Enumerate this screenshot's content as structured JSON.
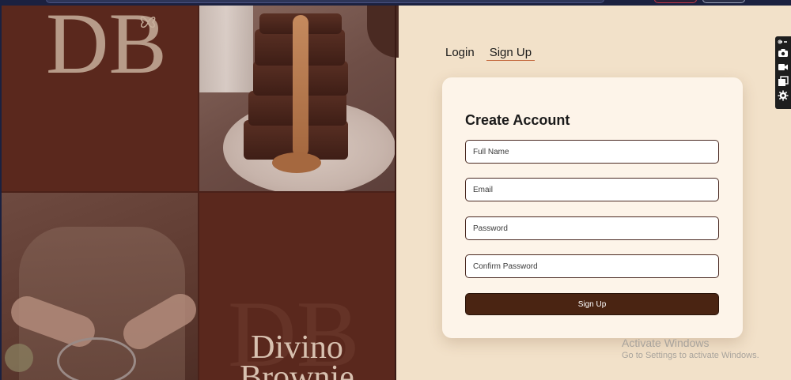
{
  "auth": {
    "tabs": [
      {
        "label": "Login",
        "active": false
      },
      {
        "label": "Sign Up",
        "active": true
      }
    ],
    "form": {
      "title": "Create Account",
      "full_name_placeholder": "Full Name",
      "email_placeholder": "Email",
      "password_placeholder": "Password",
      "confirm_password_placeholder": "Confirm Password",
      "submit_label": "Sign Up"
    }
  },
  "brand": {
    "name_line1": "Divino",
    "name_line2": "Brownie",
    "monogram": "DB"
  },
  "os_overlay": {
    "activate_title": "Activate Windows",
    "activate_subtitle": "Go to Settings to activate Windows."
  },
  "colors": {
    "panel_bg": "#f2e1c9",
    "card_bg": "#fdf4e9",
    "brand_brown": "#5a281d",
    "button_brown": "#4a2412",
    "tab_underline": "#c46a40"
  },
  "icons": {
    "toolbar": [
      "link-icon",
      "camera-icon",
      "video-icon",
      "copy-icon",
      "gear-icon"
    ]
  }
}
